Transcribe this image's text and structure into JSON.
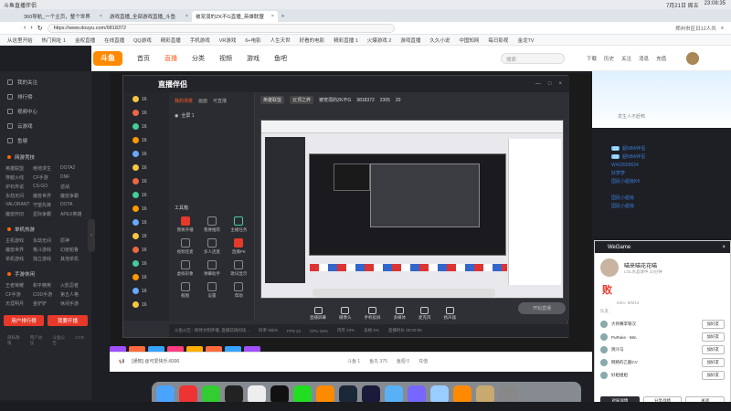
{
  "window": {
    "title": "斗鱼直播伴侣",
    "date": "7月21日 周五",
    "time": "23:08:35"
  },
  "tabs": [
    {
      "label": "360导航_一个主页，整个世界"
    },
    {
      "label": "游戏直播_全部游戏直播_斗鱼"
    },
    {
      "label": "被宠溺的ZK不G直播_英雄联盟"
    }
  ],
  "address": {
    "url": "https://www.douyu.com/9818372",
    "location": "郑州市区日12人共"
  },
  "bookmarks": [
    "从这里开始",
    "热门网址 1",
    "金权直播",
    "在线直播",
    "QQ游戏",
    "精彩直播",
    "手机游戏",
    "VR游戏",
    "6+电影",
    "人生天世",
    "好看的电影",
    "精彩直播 1",
    "火爆游戏 2",
    "游戏直播",
    "久久小说",
    "中国知网",
    "每日影视",
    "金龙TV"
  ],
  "douyu": {
    "nav": [
      "首页",
      "直播",
      "分类",
      "视频",
      "游戏",
      "鱼吧"
    ],
    "search_placeholder": "搜索",
    "header_icons": [
      "下载",
      "历史",
      "关注",
      "消息",
      "充值"
    ]
  },
  "left_sidebar": {
    "items": [
      "我的关注",
      "排行榜",
      "视频中心",
      "云游戏",
      "鱼塘"
    ],
    "section_games": "网游竞技",
    "games": [
      "英雄联盟",
      "绝地求生",
      "DOTA2",
      "穿越火线",
      "CF手游",
      "DNF",
      "炉石传说",
      "CS:GO",
      "逆战",
      "永劫无间",
      "魔兽世界",
      "魔兽争霸",
      "VALORANT",
      "守望先锋",
      "DOTA",
      "魔兽怀旧",
      "星际争霸",
      "APEX英雄"
    ],
    "section_single": "单机热游",
    "single": [
      "主机游戏",
      "永劫无间",
      "原神",
      "魔兽世界",
      "格斗游戏",
      "幻兽帕鲁",
      "单机游戏",
      "独立游戏",
      "其他单机"
    ],
    "section_mobile": "手游休闲",
    "mobile": [
      "王者荣耀",
      "和平精英",
      "火影忍者",
      "CF手游",
      "COD手游",
      "第五人格",
      "天涯明月",
      "金铲铲",
      "休闲手游"
    ],
    "btn_open": "用户排行榜",
    "btn_live": "我要开播",
    "footer": [
      "隐私政策",
      "用户协议",
      "斗鱼公告",
      "CCR"
    ]
  },
  "app": {
    "title": "直播伴侣",
    "tabs": [
      "我的场景",
      "画面",
      "可直播"
    ],
    "scene": "全屏 1",
    "tools_label": "工具箱",
    "tools": [
      "我要开播",
      "我要推荐",
      "主播任务",
      "视频连麦",
      "多人连麦",
      "直播PK",
      "虚拟形象",
      "弹幕助手",
      "歌词显示",
      "截图",
      "设置",
      "帮助"
    ],
    "stream_info": {
      "category": "英雄联盟",
      "subcat": "云顶之弈",
      "streamer": "被宠溺的ZK不G",
      "room": "9818372",
      "viewers": "2305",
      "fans": "20"
    },
    "bottom_btns": [
      "直播屏幕",
      "摄像头",
      "手机投屏",
      "多媒体",
      "麦克风",
      "扬声器"
    ],
    "start_live": "开始直播",
    "status": [
      "斗鱼公告 : 保持文明开播, 直播前请阅读...",
      "码率 0kb/s",
      "FPS 22",
      "CPU 16%",
      "内存 23%",
      "丢帧 0%",
      "直播时长 00:00:00"
    ],
    "game_list": [
      "16",
      "16",
      "16",
      "16",
      "16",
      "16",
      "16",
      "16",
      "16",
      "16",
      "16",
      "16",
      "16",
      "16",
      "16",
      "16"
    ]
  },
  "chat": {
    "banner_label": "发生人不赶鸭",
    "lines": [
      {
        "lv": "",
        "name": "",
        "text": "01"
      },
      {
        "lv": "",
        "name": "",
        "text": "0"
      },
      {
        "lv": "23",
        "name": "超NBA伴侣",
        "text": "好家伙"
      },
      {
        "lv": "23",
        "name": "超NBA伴侣",
        "text": "777"
      },
      {
        "lv": "",
        "name": "W415559634",
        "text": "欢迎来到本直播间"
      },
      {
        "lv": "",
        "name": "好梦梦",
        "text": "欢迎来到本直播间"
      },
      {
        "lv": "",
        "name": "国民小超级KK",
        "text": "欢迎来到本直播间"
      },
      {
        "lv": "",
        "name": "",
        "text": "主播"
      },
      {
        "lv": "",
        "name": "国民小超级",
        "text": ""
      },
      {
        "lv": "",
        "name": "国民小超级",
        "text": "4302"
      }
    ]
  },
  "wegame": {
    "title": "WeGame",
    "profile_name": "喵来喵花花喵",
    "profile_sub": "LOL水晶球中 23分钟",
    "result": "败",
    "stats": "KDA: 8/6/14",
    "section": "队友",
    "rows": [
      "大师赛李铁汉",
      "PuRuke · 86n",
      "阴冷马",
      "网络的乙酸CV",
      "好姐姐姐"
    ],
    "btn_add": "加好友",
    "footer_btns": [
      "对局详情",
      "分享战绩",
      "关闭"
    ]
  },
  "footer": {
    "info": "[通知] @可爱快乐-8300",
    "items": [
      "斗鱼 1",
      "鱼丸 375",
      "鱼翅 0",
      "充值"
    ]
  },
  "dock_apps": [
    "finder",
    "netease",
    "music",
    "capcut",
    "chrome",
    "qq",
    "wechat",
    "douyu",
    "steam",
    "ps",
    "folder",
    "app",
    "weather",
    "douyu2",
    "lol",
    "trash"
  ],
  "colors": {
    "accent": "#ff5d23",
    "live_red": "#e6392a",
    "sidebar_bg": "#25272d"
  }
}
